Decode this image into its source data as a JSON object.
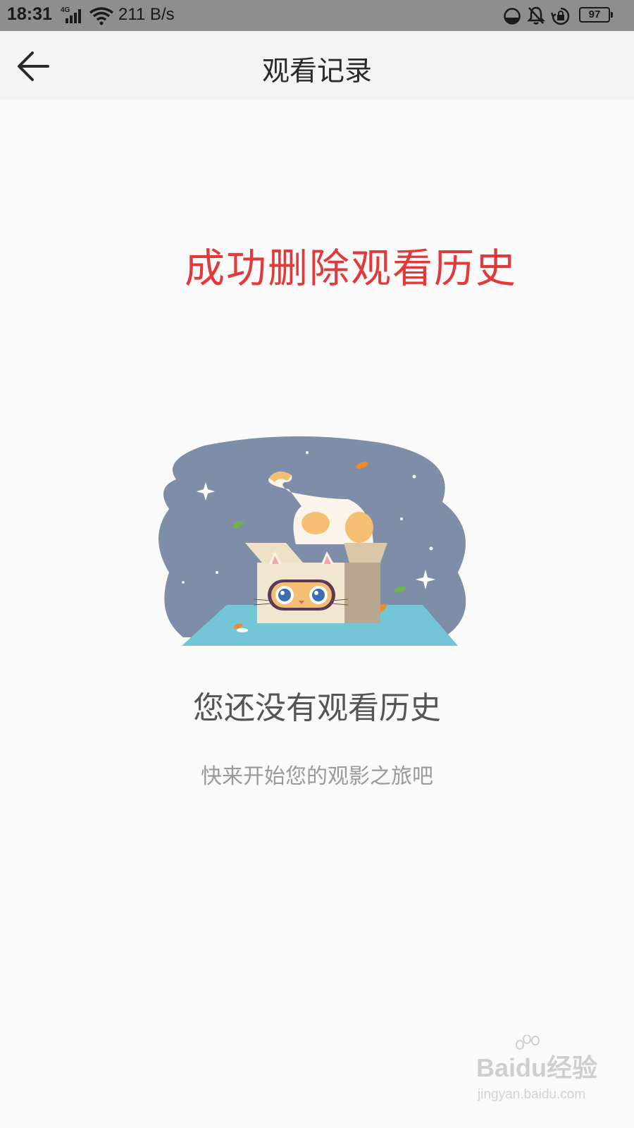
{
  "status_bar": {
    "time": "18:31",
    "network_label": "4G",
    "speed": "211 B/s",
    "battery": "97",
    "icons": [
      "signal-icon",
      "wifi-icon",
      "data-saver-icon",
      "bell-muted-icon",
      "rotation-lock-icon",
      "battery-icon"
    ]
  },
  "nav": {
    "back_icon": "arrow-left-icon",
    "title": "观看记录"
  },
  "overlay": {
    "success_message": "成功删除观看历史"
  },
  "empty_state": {
    "illustration": "cat-in-box",
    "title": "您还没有观看历史",
    "subtitle": "快来开始您的观影之旅吧"
  },
  "watermark": {
    "brand": "Baidu经验",
    "url": "jingyan.baidu.com"
  },
  "colors": {
    "success_red": "#e23a3a",
    "nav_background": "#f4f4f4",
    "status_background": "#8e8e8e",
    "page_background": "#fafafa"
  }
}
